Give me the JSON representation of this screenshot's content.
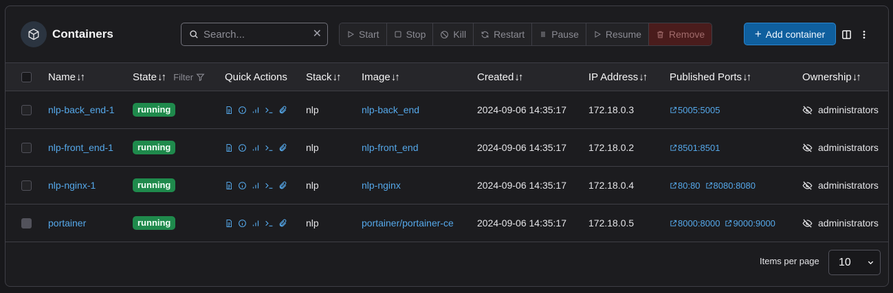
{
  "header": {
    "title": "Containers",
    "title_icon": "cube-icon"
  },
  "search": {
    "placeholder": "Search...",
    "value": ""
  },
  "actions": {
    "start": "Start",
    "stop": "Stop",
    "kill": "Kill",
    "restart": "Restart",
    "pause": "Pause",
    "resume": "Resume",
    "remove": "Remove",
    "add_container": "Add container"
  },
  "columns": {
    "name": "Name",
    "state": "State",
    "state_filter": "Filter",
    "quick_actions": "Quick Actions",
    "stack": "Stack",
    "image": "Image",
    "created": "Created",
    "ip": "IP Address",
    "ports": "Published Ports",
    "ownership": "Ownership"
  },
  "rows": [
    {
      "name": "nlp-back_end-1",
      "state": "running",
      "stack": "nlp",
      "image": "nlp-back_end",
      "created": "2024-09-06 14:35:17",
      "ip": "172.18.0.3",
      "ports": [
        "5005:5005"
      ],
      "ownership": "administrators"
    },
    {
      "name": "nlp-front_end-1",
      "state": "running",
      "stack": "nlp",
      "image": "nlp-front_end",
      "created": "2024-09-06 14:35:17",
      "ip": "172.18.0.2",
      "ports": [
        "8501:8501"
      ],
      "ownership": "administrators"
    },
    {
      "name": "nlp-nginx-1",
      "state": "running",
      "stack": "nlp",
      "image": "nlp-nginx",
      "created": "2024-09-06 14:35:17",
      "ip": "172.18.0.4",
      "ports": [
        "80:80",
        "8080:8080"
      ],
      "ownership": "administrators"
    },
    {
      "name": "portainer",
      "state": "running",
      "stack": "nlp",
      "image": "portainer/portainer-ce",
      "created": "2024-09-06 14:35:17",
      "ip": "172.18.0.5",
      "ports": [
        "8000:8000",
        "9000:9000"
      ],
      "ownership": "administrators"
    }
  ],
  "pagination": {
    "label": "Items per page",
    "value": "10"
  },
  "colors": {
    "accent": "#0f5f9e",
    "link": "#55a8ea",
    "running": "#1f8a4c",
    "remove": "#4a1c1c"
  }
}
